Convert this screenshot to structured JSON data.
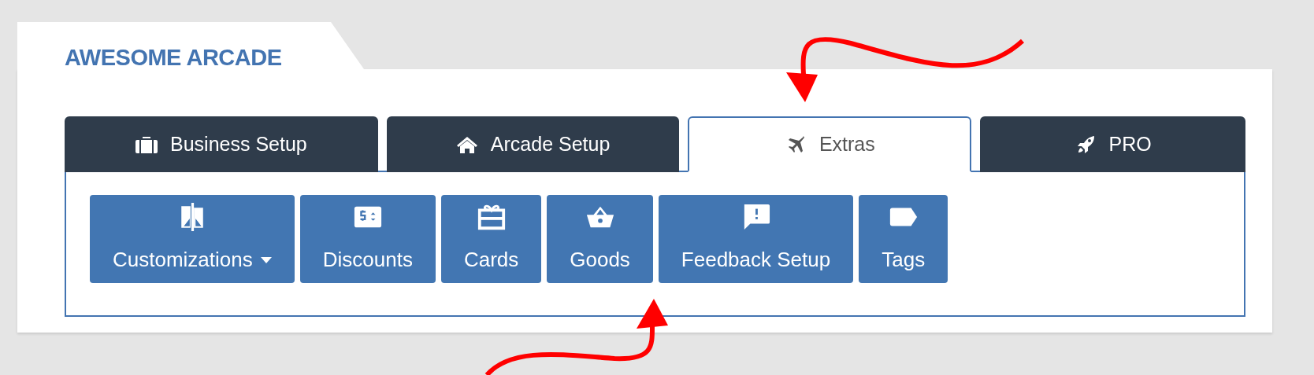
{
  "title": "AWESOME ARCADE",
  "tabs": [
    {
      "label": "Business Setup",
      "selected": false
    },
    {
      "label": "Arcade Setup",
      "selected": false
    },
    {
      "label": "Extras",
      "selected": true
    },
    {
      "label": "PRO",
      "selected": false
    }
  ],
  "buttons": [
    {
      "label": "Customizations",
      "dropdown": true
    },
    {
      "label": "Discounts",
      "dropdown": false
    },
    {
      "label": "Cards",
      "dropdown": false
    },
    {
      "label": "Goods",
      "dropdown": false
    },
    {
      "label": "Feedback Setup",
      "dropdown": false
    },
    {
      "label": "Tags",
      "dropdown": false
    }
  ]
}
